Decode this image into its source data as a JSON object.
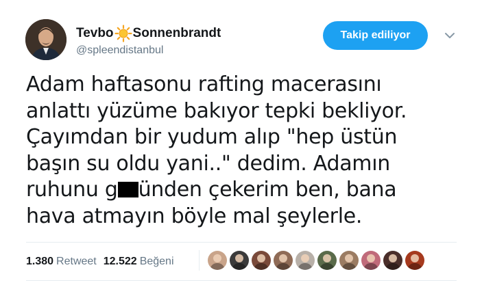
{
  "user": {
    "name_part1": "Tevbo",
    "name_part2": "Sonnenbrandt",
    "handle": "@spleendistanbul",
    "name_emoji_icon": "sun-icon"
  },
  "actions": {
    "follow_label": "Takip ediliyor",
    "menu_icon": "chevron-down-icon"
  },
  "tweet": {
    "line1": "Adam haftasonu rafting macerasını",
    "line2": "anlattı yüzüme bakıyor tepki bekliyor.",
    "line3": "Çayımdan bir yudum alıp \"hep üstün",
    "line4": "başın su oldu yani..\" dedim. Adamın",
    "line5a": "ruhunu g",
    "line5b": "ünden çekerim ben, bana",
    "line6": "hava atmayın böyle mal şeylerle."
  },
  "stats": {
    "retweets": "1.380",
    "retweets_label": "Retweet",
    "likes": "12.522",
    "likes_label": "Beğeni"
  },
  "colors": {
    "accent": "#1da1f2",
    "secondary_text": "#657786",
    "divider": "#e6ecf0"
  },
  "likers": [
    {
      "color": "#c9a48a"
    },
    {
      "color": "#3b3b3b"
    },
    {
      "color": "#7a4a3a"
    },
    {
      "color": "#8f6b56"
    },
    {
      "color": "#b8b0a8"
    },
    {
      "color": "#5a6b4a"
    },
    {
      "color": "#9b7c62"
    },
    {
      "color": "#c06a7a"
    },
    {
      "color": "#4a2e2a"
    },
    {
      "color": "#a63a1e"
    }
  ]
}
